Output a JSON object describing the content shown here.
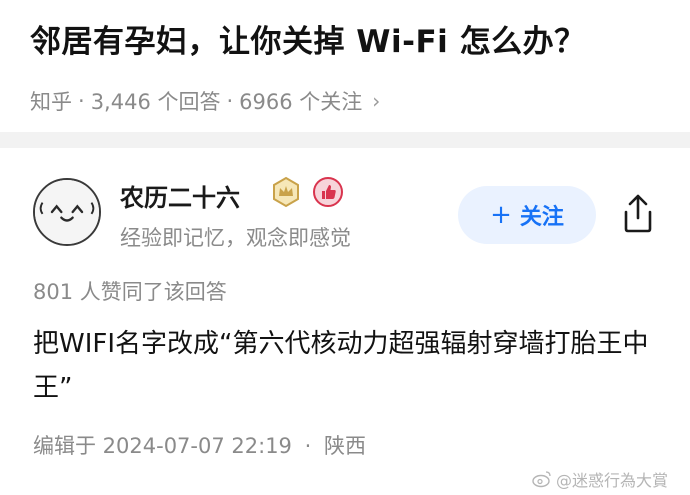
{
  "question": {
    "title": "邻居有孕妇，让你关掉 Wi-Fi 怎么办？",
    "source": "知乎",
    "answers_count": "3,446 个回答",
    "followers_count": "6966 个关注",
    "separator": "·",
    "chevron": "›"
  },
  "author": {
    "name": "农历二十六",
    "bio": "经验即记忆，观念即感觉",
    "follow_plus": "+",
    "follow_label": "关注",
    "badges": [
      "crown-badge-icon",
      "like-badge-icon"
    ]
  },
  "answer": {
    "likes_line": "801 人赞同了该回答",
    "content": "把WIFI名字改成“第六代核动力超强辐射穿墙打胎王中王”",
    "edited_prefix": "编辑于 2024-07-07 22:19",
    "separator": "·",
    "location": "陕西"
  },
  "watermark": {
    "text": "@迷惑行為大賞",
    "icon": "weibo-logo-icon"
  },
  "colors": {
    "accent": "#1772f6",
    "follow_bg": "#eaf2ff",
    "muted": "#8a8a8a",
    "divider": "#f2f2f2",
    "badge_gold": "#c9a24a",
    "badge_red": "#d9344e"
  }
}
